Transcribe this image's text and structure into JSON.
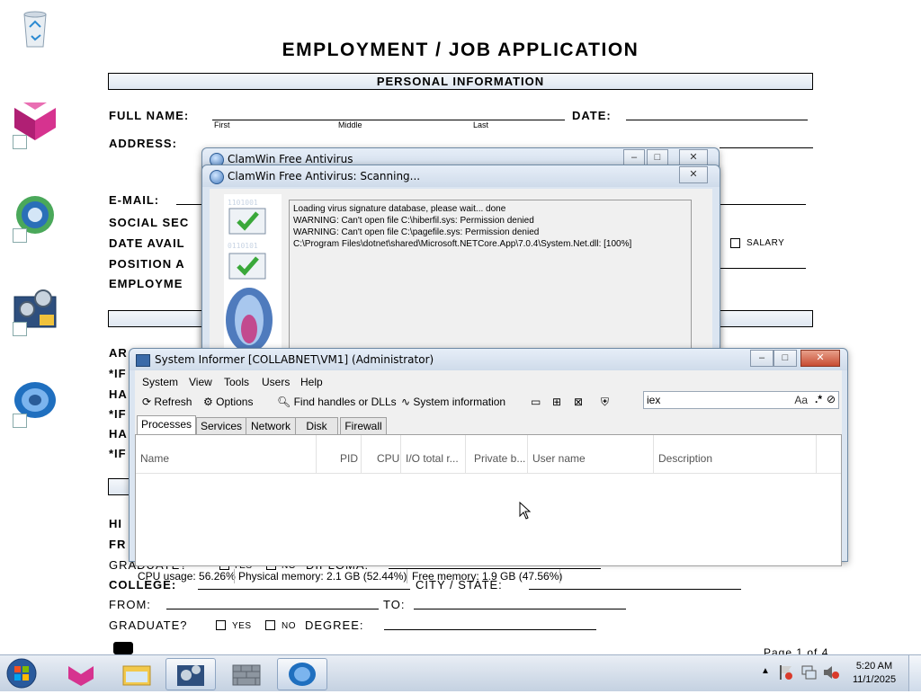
{
  "desktop": {
    "icons": [
      "recycle-bin-icon",
      "purple-shield-shortcut-icon",
      "globe-shortcut-icon",
      "gear-tools-shortcut-icon",
      "clam-shortcut-icon"
    ]
  },
  "document": {
    "title": "EMPLOYMENT / JOB APPLICATION",
    "section_personal": "PERSONAL INFORMATION",
    "full_name": "FULL NAME:",
    "first": "First",
    "middle": "Middle",
    "last": "Last",
    "date": "DATE:",
    "address": "ADDRESS:",
    "email": "E-MAIL:",
    "social": "SOCIAL SEC",
    "date_avail": "DATE AVAIL",
    "position": "POSITION A",
    "employment": "EMPLOYME",
    "salary": "SALARY",
    "ar": "AR",
    "if1": "*IF",
    "ha1": "HA",
    "if2": "*IF",
    "ha2": "HA",
    "if3": "*IF",
    "hi": "HI",
    "fr": "FR",
    "graduate1": "GRADUATE?",
    "yes": "YES",
    "no": "NO",
    "diploma": "DIPLOMA:",
    "college": "COLLEGE:",
    "city_state": "CITY / STATE:",
    "from": "FROM:",
    "to": "TO:",
    "graduate2": "GRADUATE?",
    "degree": "DEGREE:",
    "page": "Page 1 of 4"
  },
  "clamwin_main": {
    "title": "ClamWin Free Antivirus"
  },
  "clamwin_scan": {
    "title": "ClamWin Free Antivirus: Scanning...",
    "log": [
      "Loading virus signature database, please wait... done",
      "WARNING: Can't open file C:\\hiberfil.sys: Permission denied",
      "WARNING: Can't open file C:\\pagefile.sys: Permission denied",
      "C:\\Program Files\\dotnet\\shared\\Microsoft.NETCore.App\\7.0.4\\System.Net.dll: [100%]"
    ]
  },
  "sysinformer": {
    "title": "System Informer [COLLABNET\\VM1] (Administrator)",
    "menu": [
      "System",
      "View",
      "Tools",
      "Users",
      "Help"
    ],
    "toolbar": {
      "refresh": "Refresh",
      "options": "Options",
      "find": "Find handles or DLLs",
      "sysinfo": "System information"
    },
    "search_value": "iex",
    "search_case": "Aa",
    "search_regex": ".*",
    "tabs": [
      "Processes",
      "Services",
      "Network",
      "Disk",
      "Firewall"
    ],
    "columns": [
      "Name",
      "PID",
      "CPU",
      "I/O total r...",
      "Private b...",
      "User name",
      "Description"
    ],
    "status": {
      "cpu": "CPU usage: 56.26%",
      "physical": "Physical memory: 2.1 GB (52.44%)",
      "free": "Free memory: 1.9 GB (47.56%)"
    }
  },
  "taskbar": {
    "time": "5:20 AM",
    "date": "11/1/2025"
  },
  "colors": {
    "accent": "#4a7fc0",
    "close": "#c74c32",
    "check_green": "#3aa83a"
  }
}
